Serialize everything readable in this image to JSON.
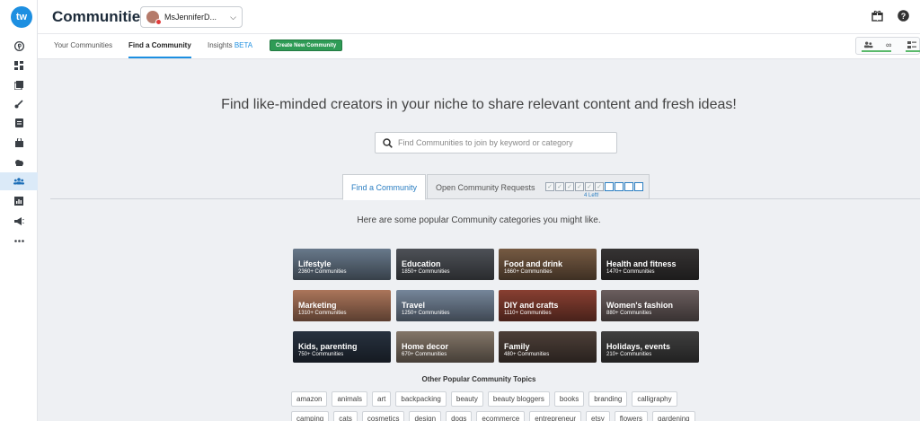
{
  "app": {
    "logo_text": "tw",
    "title": "Communities"
  },
  "account": {
    "name": "MsJenniferD..."
  },
  "sidebar": {
    "items": [
      {
        "icon": "pinterest-icon"
      },
      {
        "icon": "dashboard-icon"
      },
      {
        "icon": "gallery-icon"
      },
      {
        "icon": "brush-icon"
      },
      {
        "icon": "document-icon"
      },
      {
        "icon": "bag-icon"
      },
      {
        "icon": "cloud-icon"
      },
      {
        "icon": "communities-icon",
        "active": true
      },
      {
        "icon": "chart-icon"
      },
      {
        "icon": "megaphone-icon"
      },
      {
        "icon": "more-icon"
      }
    ]
  },
  "subnav": {
    "tabs": [
      {
        "label": "Your Communities"
      },
      {
        "label": "Find a Community"
      },
      {
        "label": "Insights",
        "suffix": "BETA"
      }
    ],
    "create_button": "Create New Community",
    "right_panel": {
      "infinity": "∞"
    }
  },
  "main": {
    "headline": "Find like-minded creators in your niche to share relevant content and fresh ideas!",
    "search_placeholder": "Find Communities to join by keyword or category",
    "tab_find": "Find a Community",
    "tab_requests": "Open Community Requests",
    "requests_left": "4 Left!",
    "subhead": "Here are some popular Community categories you might like.",
    "categories": [
      {
        "name": "Lifestyle",
        "count": "2360+ Communities",
        "color": "#7a8ea3"
      },
      {
        "name": "Education",
        "count": "1850+ Communities",
        "color": "#5b5f66"
      },
      {
        "name": "Food and drink",
        "count": "1660+ Communities",
        "color": "#8a6a4e"
      },
      {
        "name": "Health and fitness",
        "count": "1470+ Communities",
        "color": "#3f3c3c"
      },
      {
        "name": "Marketing",
        "count": "1310+ Communities",
        "color": "#c98a6a"
      },
      {
        "name": "Travel",
        "count": "1250+ Communities",
        "color": "#8a9db5"
      },
      {
        "name": "DIY and crafts",
        "count": "1110+ Communities",
        "color": "#a04a3a"
      },
      {
        "name": "Women's fashion",
        "count": "880+ Communities",
        "color": "#7d6e6e"
      },
      {
        "name": "Kids, parenting",
        "count": "750+ Communities",
        "color": "#2e3a4a"
      },
      {
        "name": "Home decor",
        "count": "670+ Communities",
        "color": "#9a8a7a"
      },
      {
        "name": "Family",
        "count": "480+ Communities",
        "color": "#5a4a42"
      },
      {
        "name": "Holidays, events",
        "count": "210+ Communities",
        "color": "#4a4a4a"
      }
    ],
    "other_title": "Other Popular Community Topics",
    "topics": [
      "amazon",
      "animals",
      "art",
      "backpacking",
      "beauty",
      "beauty bloggers",
      "books",
      "branding",
      "calligraphy",
      "camping",
      "cats",
      "cosmetics",
      "design",
      "dogs",
      "ecommerce",
      "entrepreneur",
      "etsy",
      "flowers",
      "gardening"
    ]
  }
}
